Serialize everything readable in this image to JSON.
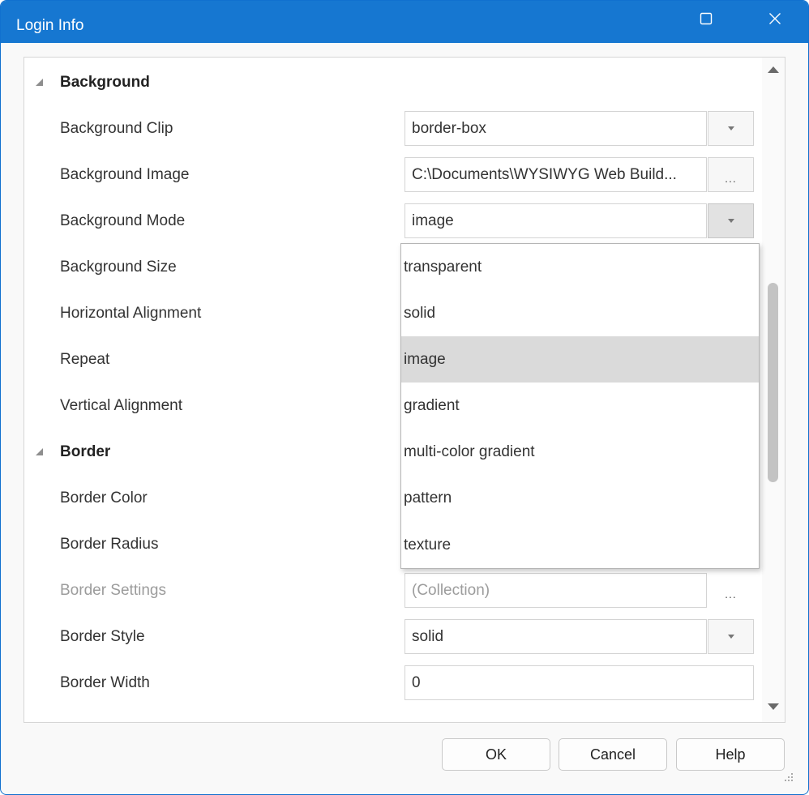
{
  "window": {
    "title": "Login Info",
    "maximize_icon": "maximize-icon",
    "close_icon": "close-icon",
    "accent_color": "#1677d1"
  },
  "properties": {
    "background_category": "Background",
    "background_clip": {
      "label": "Background Clip",
      "value": "border-box"
    },
    "background_image": {
      "label": "Background Image",
      "value": "C:\\Documents\\WYSIWYG Web Build..."
    },
    "background_mode": {
      "label": "Background Mode",
      "value": "image"
    },
    "background_size": {
      "label": "Background Size"
    },
    "horizontal_alignment": {
      "label": "Horizontal Alignment"
    },
    "repeat": {
      "label": "Repeat"
    },
    "vertical_alignment": {
      "label": "Vertical Alignment"
    },
    "border_category": "Border",
    "border_color": {
      "label": "Border Color"
    },
    "border_radius": {
      "label": "Border Radius"
    },
    "border_settings": {
      "label": "Border Settings",
      "value": "(Collection)"
    },
    "border_style": {
      "label": "Border Style",
      "value": "solid"
    },
    "border_width": {
      "label": "Border Width",
      "value": "0"
    },
    "ellipsis_label": "..."
  },
  "dropdown": {
    "selected": "image",
    "options": [
      "transparent",
      "solid",
      "image",
      "gradient",
      "multi-color gradient",
      "pattern",
      "texture"
    ]
  },
  "buttons": {
    "ok": "OK",
    "cancel": "Cancel",
    "help": "Help"
  }
}
